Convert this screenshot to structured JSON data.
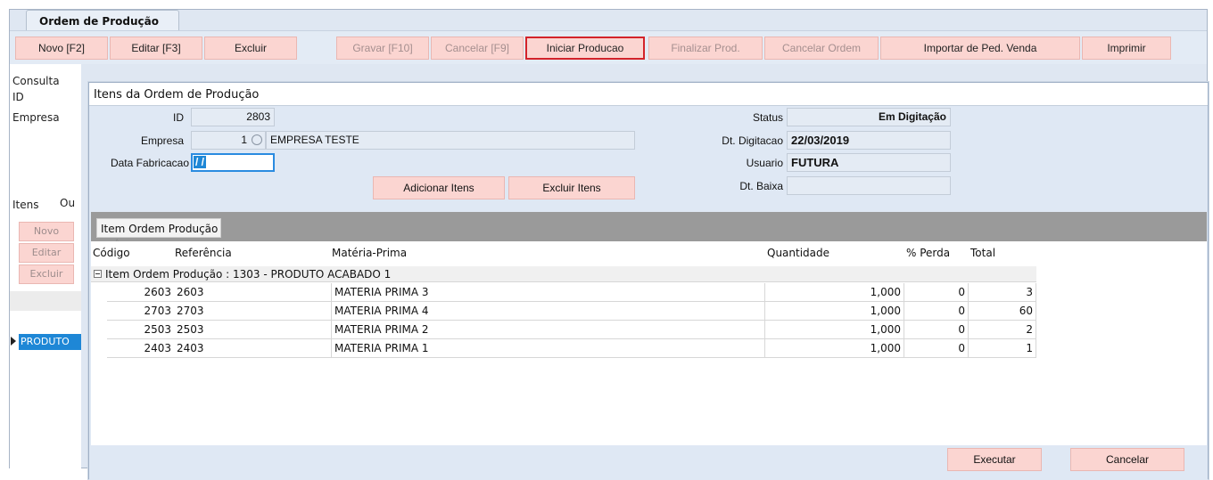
{
  "tab": {
    "title": "Ordem de Produção",
    "close": "✕"
  },
  "toolbar": {
    "novo": "Novo [F2]",
    "editar": "Editar [F3]",
    "excluir": "Excluir",
    "gravar": "Gravar [F10]",
    "cancelar": "Cancelar [F9]",
    "iniciar": "Iniciar Producao",
    "finalizar": "Finalizar Prod.",
    "cancelar_ordem": "Cancelar Ordem",
    "importar": "Importar de Ped. Venda",
    "imprimir": "Imprimir"
  },
  "background": {
    "consulta": "Consulta",
    "id_label": "ID",
    "empresa_label": "Empresa",
    "itens_tab": "Itens",
    "outros_tab": "Ou",
    "novo": "Novo",
    "editar": "Editar",
    "excluir": "Excluir",
    "produto": "PRODUTO"
  },
  "dialog": {
    "title": "Itens da Ordem de Produção",
    "id_label": "ID",
    "id_value": "2803",
    "empresa_label": "Empresa",
    "empresa_code": "1",
    "empresa_name": "EMPRESA TESTE",
    "data_fab_label": "Data Fabricacao",
    "data_fab_value": "/ /",
    "status_label": "Status",
    "status_value": "Em Digitação",
    "dt_dig_label": "Dt. Digitacao",
    "dt_dig_value": "22/03/2019",
    "usuario_label": "Usuario",
    "usuario_value": "FUTURA",
    "dt_baixa_label": "Dt. Baixa",
    "dt_baixa_value": "",
    "adicionar": "Adicionar Itens",
    "excluir_itens": "Excluir Itens",
    "executar": "Executar",
    "cancelar": "Cancelar"
  },
  "grid": {
    "group_chip": "Item Ordem Produção",
    "group_sort": "△",
    "headers": {
      "codigo": "Código",
      "referencia": "Referência",
      "materia": "Matéria-Prima",
      "quantidade": "Quantidade",
      "perda": "% Perda",
      "total": "Total"
    },
    "group_row": "Item Ordem Produção : 1303 - PRODUTO ACABADO 1",
    "rows": [
      {
        "codigo": "2603",
        "referencia": "2603",
        "materia": "MATERIA PRIMA 3",
        "quantidade": "1,000",
        "perda": "0",
        "total": "3"
      },
      {
        "codigo": "2703",
        "referencia": "2703",
        "materia": "MATERIA PRIMA 4",
        "quantidade": "1,000",
        "perda": "0",
        "total": "60"
      },
      {
        "codigo": "2503",
        "referencia": "2503",
        "materia": "MATERIA PRIMA 2",
        "quantidade": "1,000",
        "perda": "0",
        "total": "2"
      },
      {
        "codigo": "2403",
        "referencia": "2403",
        "materia": "MATERIA PRIMA 1",
        "quantidade": "1,000",
        "perda": "0",
        "total": "1"
      }
    ]
  }
}
